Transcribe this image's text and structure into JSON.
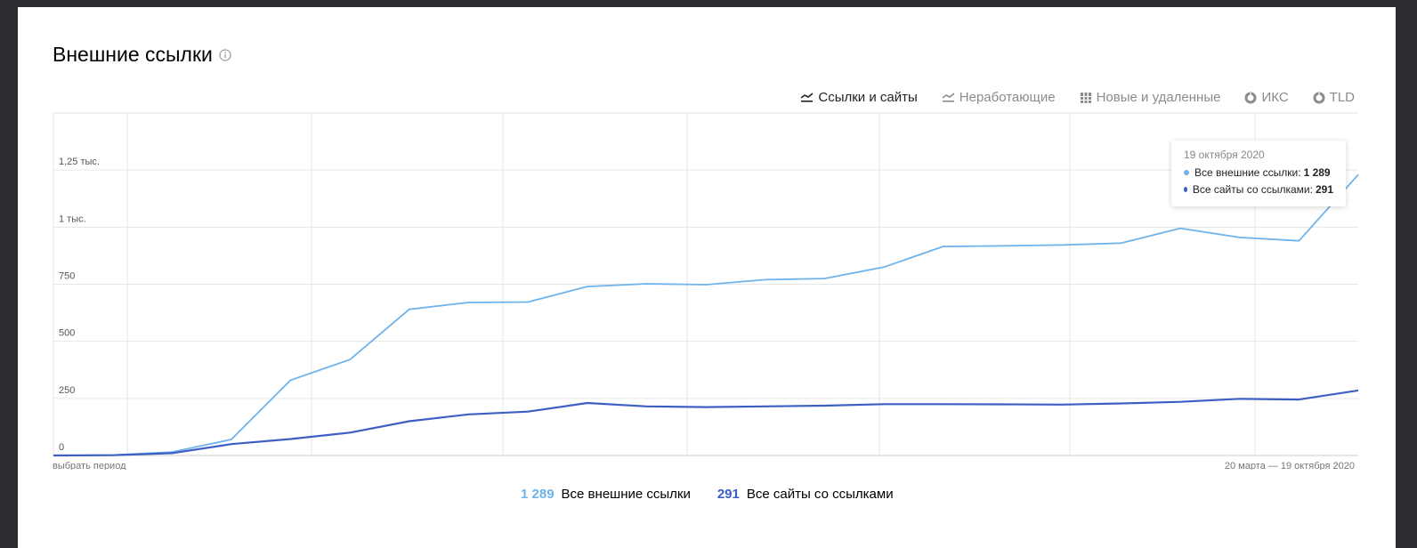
{
  "header": {
    "title": "Внешние ссылки",
    "info_icon": "info-icon"
  },
  "toolbar": {
    "items": [
      {
        "label": "Ссылки и сайты",
        "icon": "line-chart-icon",
        "active": true
      },
      {
        "label": "Неработающие",
        "icon": "line-chart-icon",
        "active": false
      },
      {
        "label": "Новые и удаленные",
        "icon": "bar-chart-icon",
        "active": false
      },
      {
        "label": "ИКС",
        "icon": "pie-chart-icon",
        "active": false
      },
      {
        "label": "TLD",
        "icon": "pie-chart-icon",
        "active": false
      }
    ]
  },
  "colors": {
    "light_series": "#6eb3ec",
    "dark_series": "#3d5fc4",
    "grid": "#e6e6e6"
  },
  "chart_data": {
    "type": "line",
    "y_tick_labels": [
      "0",
      "250",
      "500",
      "750",
      "1 тыс.",
      "1,25 тыс."
    ],
    "y_ticks": [
      0,
      250,
      500,
      750,
      1000,
      1250
    ],
    "ylim": [
      0,
      1500
    ],
    "x_left_label": "выбрать период",
    "x_right_label": "20 марта — 19 октября 2020",
    "grid": true,
    "legend_position": "bottom-center",
    "series": [
      {
        "name": "Все внешние ссылки",
        "color": "#6eb3ec",
        "values": [
          0,
          2,
          15,
          70,
          330,
          420,
          640,
          670,
          672,
          740,
          752,
          748,
          770,
          775,
          825,
          915,
          918,
          922,
          930,
          995,
          955,
          940,
          1230
        ]
      },
      {
        "name": "Все сайты со ссылками",
        "color": "#3d5fc4",
        "values": [
          0,
          1,
          10,
          50,
          72,
          100,
          150,
          180,
          192,
          230,
          215,
          212,
          215,
          218,
          225,
          225,
          224,
          223,
          228,
          235,
          248,
          245,
          285
        ]
      }
    ]
  },
  "tooltip": {
    "date": "19 октября 2020",
    "rows": [
      {
        "label": "Все внешние ссылки:",
        "value": "1 289"
      },
      {
        "label": "Все сайты со ссылками:",
        "value": "291"
      }
    ]
  },
  "legend": {
    "items": [
      {
        "value": "1 289",
        "label": "Все внешние ссылки"
      },
      {
        "value": "291",
        "label": "Все сайты со ссылками"
      }
    ]
  }
}
